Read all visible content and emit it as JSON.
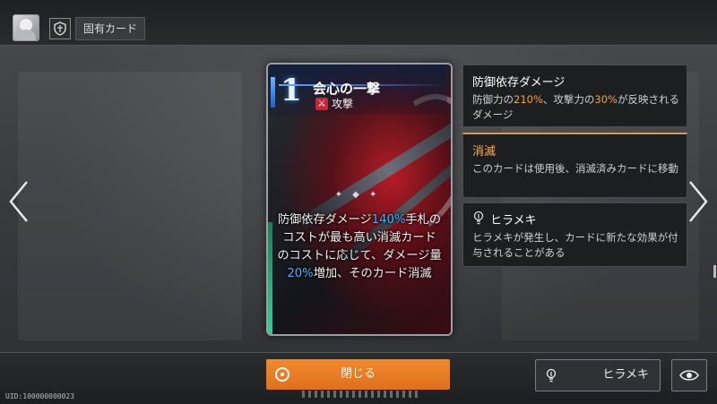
{
  "header": {
    "tab_label": "固有カード"
  },
  "card": {
    "cost": "1",
    "name": "会心の一撃",
    "type_icon": "⚔",
    "type": "攻撃",
    "description": {
      "p1": "防御依存ダメージ",
      "v1": "140%",
      "p2": "手札のコストが最も高い消滅カードのコストに応じて、ダメージ量",
      "v2": "20%",
      "p3": "増加、そのカード消滅"
    }
  },
  "keywords": [
    {
      "title": "防御依存ダメージ",
      "text_a": "防御力の",
      "val_a": "210%",
      "text_b": "、攻撃力の",
      "val_b": "30%",
      "text_c": "が反映されるダメージ"
    },
    {
      "title": "消滅",
      "text": "このカードは使用後、消滅済みカードに移動"
    },
    {
      "title": "ヒラメキ",
      "text": "ヒラメキが発生し、カードに新たな効果が付与されることがある"
    }
  ],
  "footer": {
    "close_label": "閉じる",
    "hirameki_label": "ヒラメキ",
    "uid": "UID:100000000023"
  },
  "colors": {
    "accent_orange": "#f08a2e",
    "highlight_blue": "#3fb6ff",
    "highlight_orange": "#f0a24a",
    "attack_red": "#c22733"
  }
}
